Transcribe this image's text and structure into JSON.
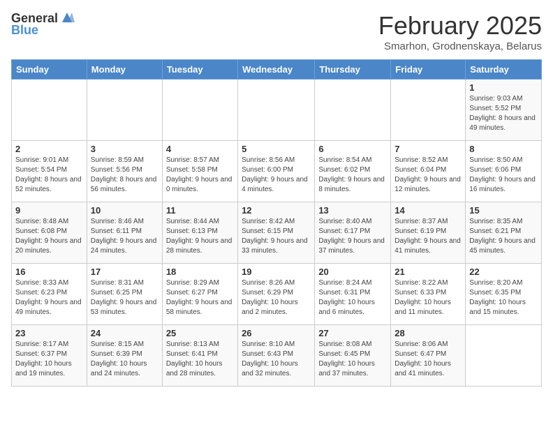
{
  "header": {
    "logo_general": "General",
    "logo_blue": "Blue",
    "title": "February 2025",
    "subtitle": "Smarhon, Grodnenskaya, Belarus"
  },
  "weekdays": [
    "Sunday",
    "Monday",
    "Tuesday",
    "Wednesday",
    "Thursday",
    "Friday",
    "Saturday"
  ],
  "weeks": [
    [
      {
        "day": "",
        "info": ""
      },
      {
        "day": "",
        "info": ""
      },
      {
        "day": "",
        "info": ""
      },
      {
        "day": "",
        "info": ""
      },
      {
        "day": "",
        "info": ""
      },
      {
        "day": "",
        "info": ""
      },
      {
        "day": "1",
        "info": "Sunrise: 9:03 AM\nSunset: 5:52 PM\nDaylight: 8 hours and 49 minutes."
      }
    ],
    [
      {
        "day": "2",
        "info": "Sunrise: 9:01 AM\nSunset: 5:54 PM\nDaylight: 8 hours and 52 minutes."
      },
      {
        "day": "3",
        "info": "Sunrise: 8:59 AM\nSunset: 5:56 PM\nDaylight: 8 hours and 56 minutes."
      },
      {
        "day": "4",
        "info": "Sunrise: 8:57 AM\nSunset: 5:58 PM\nDaylight: 9 hours and 0 minutes."
      },
      {
        "day": "5",
        "info": "Sunrise: 8:56 AM\nSunset: 6:00 PM\nDaylight: 9 hours and 4 minutes."
      },
      {
        "day": "6",
        "info": "Sunrise: 8:54 AM\nSunset: 6:02 PM\nDaylight: 9 hours and 8 minutes."
      },
      {
        "day": "7",
        "info": "Sunrise: 8:52 AM\nSunset: 6:04 PM\nDaylight: 9 hours and 12 minutes."
      },
      {
        "day": "8",
        "info": "Sunrise: 8:50 AM\nSunset: 6:06 PM\nDaylight: 9 hours and 16 minutes."
      }
    ],
    [
      {
        "day": "9",
        "info": "Sunrise: 8:48 AM\nSunset: 6:08 PM\nDaylight: 9 hours and 20 minutes."
      },
      {
        "day": "10",
        "info": "Sunrise: 8:46 AM\nSunset: 6:11 PM\nDaylight: 9 hours and 24 minutes."
      },
      {
        "day": "11",
        "info": "Sunrise: 8:44 AM\nSunset: 6:13 PM\nDaylight: 9 hours and 28 minutes."
      },
      {
        "day": "12",
        "info": "Sunrise: 8:42 AM\nSunset: 6:15 PM\nDaylight: 9 hours and 33 minutes."
      },
      {
        "day": "13",
        "info": "Sunrise: 8:40 AM\nSunset: 6:17 PM\nDaylight: 9 hours and 37 minutes."
      },
      {
        "day": "14",
        "info": "Sunrise: 8:37 AM\nSunset: 6:19 PM\nDaylight: 9 hours and 41 minutes."
      },
      {
        "day": "15",
        "info": "Sunrise: 8:35 AM\nSunset: 6:21 PM\nDaylight: 9 hours and 45 minutes."
      }
    ],
    [
      {
        "day": "16",
        "info": "Sunrise: 8:33 AM\nSunset: 6:23 PM\nDaylight: 9 hours and 49 minutes."
      },
      {
        "day": "17",
        "info": "Sunrise: 8:31 AM\nSunset: 6:25 PM\nDaylight: 9 hours and 53 minutes."
      },
      {
        "day": "18",
        "info": "Sunrise: 8:29 AM\nSunset: 6:27 PM\nDaylight: 9 hours and 58 minutes."
      },
      {
        "day": "19",
        "info": "Sunrise: 8:26 AM\nSunset: 6:29 PM\nDaylight: 10 hours and 2 minutes."
      },
      {
        "day": "20",
        "info": "Sunrise: 8:24 AM\nSunset: 6:31 PM\nDaylight: 10 hours and 6 minutes."
      },
      {
        "day": "21",
        "info": "Sunrise: 8:22 AM\nSunset: 6:33 PM\nDaylight: 10 hours and 11 minutes."
      },
      {
        "day": "22",
        "info": "Sunrise: 8:20 AM\nSunset: 6:35 PM\nDaylight: 10 hours and 15 minutes."
      }
    ],
    [
      {
        "day": "23",
        "info": "Sunrise: 8:17 AM\nSunset: 6:37 PM\nDaylight: 10 hours and 19 minutes."
      },
      {
        "day": "24",
        "info": "Sunrise: 8:15 AM\nSunset: 6:39 PM\nDaylight: 10 hours and 24 minutes."
      },
      {
        "day": "25",
        "info": "Sunrise: 8:13 AM\nSunset: 6:41 PM\nDaylight: 10 hours and 28 minutes."
      },
      {
        "day": "26",
        "info": "Sunrise: 8:10 AM\nSunset: 6:43 PM\nDaylight: 10 hours and 32 minutes."
      },
      {
        "day": "27",
        "info": "Sunrise: 8:08 AM\nSunset: 6:45 PM\nDaylight: 10 hours and 37 minutes."
      },
      {
        "day": "28",
        "info": "Sunrise: 8:06 AM\nSunset: 6:47 PM\nDaylight: 10 hours and 41 minutes."
      },
      {
        "day": "",
        "info": ""
      }
    ]
  ]
}
